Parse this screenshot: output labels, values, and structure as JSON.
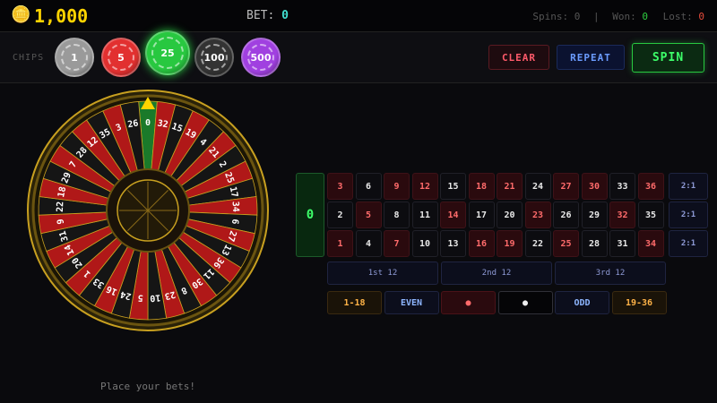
{
  "header": {
    "coin_icon": "coin-icon",
    "balance": "1,000",
    "bet_label": "BET:",
    "bet_value": "0",
    "spins_label": "Spins:",
    "spins_value": "0",
    "separator": "|",
    "won_label": "Won:",
    "won_value": "0",
    "lost_label": "Lost:",
    "lost_value": "0"
  },
  "chips": {
    "label": "CHIPS",
    "items": [
      {
        "value": "1",
        "color": "#9a9a9a"
      },
      {
        "value": "5",
        "color": "#e23030"
      },
      {
        "value": "25",
        "color": "#28c840",
        "selected": true
      },
      {
        "value": "100",
        "color": "#333333"
      },
      {
        "value": "500",
        "color": "#a040e0"
      }
    ]
  },
  "controls": {
    "clear": "CLEAR",
    "repeat": "REPEAT",
    "spin": "SPIN"
  },
  "wheel": {
    "numbers": [
      0,
      32,
      15,
      19,
      4,
      21,
      2,
      25,
      17,
      34,
      6,
      27,
      13,
      36,
      11,
      30,
      8,
      23,
      10,
      5,
      24,
      16,
      33,
      1,
      20,
      14,
      31,
      9,
      22,
      18,
      29,
      7,
      28,
      12,
      35,
      3,
      26
    ],
    "red_numbers": [
      1,
      3,
      5,
      7,
      9,
      12,
      14,
      16,
      18,
      19,
      21,
      23,
      25,
      27,
      30,
      32,
      34,
      36
    ],
    "colors": {
      "red": "#b01818",
      "black": "#151515",
      "green": "#1a7a2a",
      "rim": "#c8a020"
    }
  },
  "board": {
    "zero": "0",
    "rows": [
      [
        "3",
        "6",
        "9",
        "12",
        "15",
        "18",
        "21",
        "24",
        "27",
        "30",
        "33",
        "36"
      ],
      [
        "2",
        "5",
        "8",
        "11",
        "14",
        "17",
        "20",
        "23",
        "26",
        "29",
        "32",
        "35"
      ],
      [
        "1",
        "4",
        "7",
        "10",
        "13",
        "16",
        "19",
        "22",
        "25",
        "28",
        "31",
        "34"
      ]
    ],
    "column_bets": [
      "2:1",
      "2:1",
      "2:1"
    ],
    "dozens": [
      "1st 12",
      "2nd 12",
      "3rd 12"
    ],
    "outside": [
      "1-18",
      "EVEN",
      "●",
      "●",
      "ODD",
      "19-36"
    ]
  },
  "message": "Place your bets!"
}
